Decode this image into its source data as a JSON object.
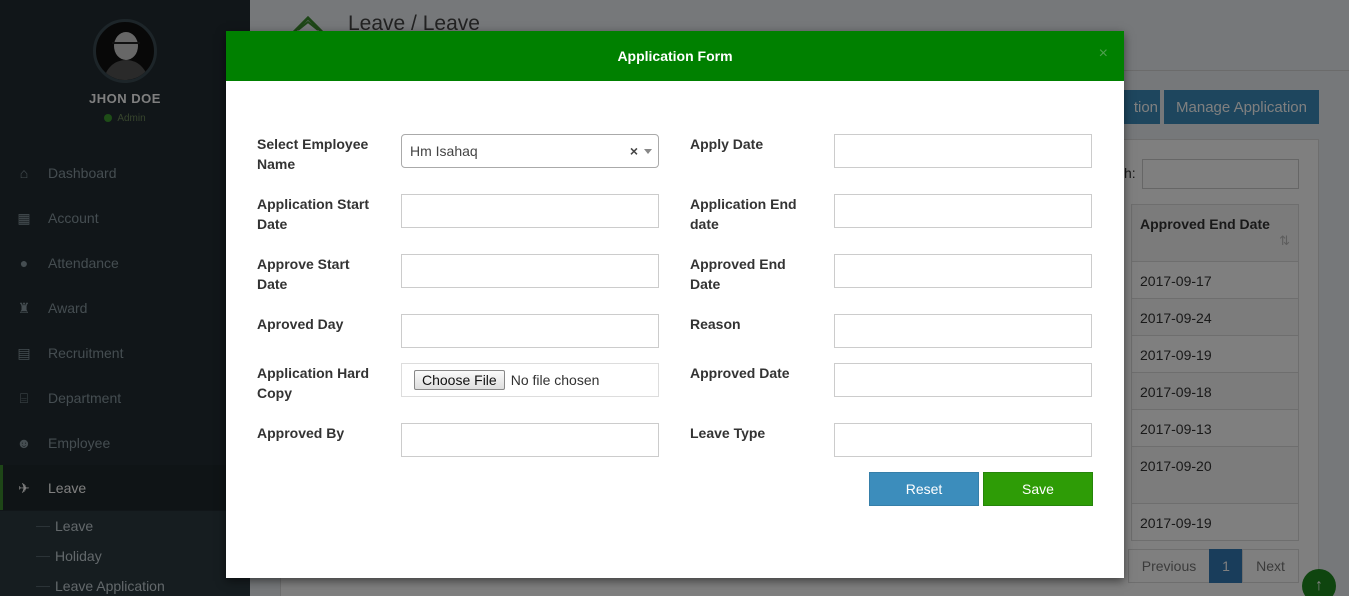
{
  "sidebar": {
    "user_name": "JHON DOE",
    "user_role": "Admin",
    "items": [
      {
        "label": "Dashboard",
        "icon": "home-icon"
      },
      {
        "label": "Account",
        "icon": "calculator-icon"
      },
      {
        "label": "Attendance",
        "icon": "user-icon"
      },
      {
        "label": "Award",
        "icon": "trophy-icon"
      },
      {
        "label": "Recruitment",
        "icon": "newspaper-icon"
      },
      {
        "label": "Department",
        "icon": "bank-icon"
      },
      {
        "label": "Employee",
        "icon": "users-icon"
      },
      {
        "label": "Leave",
        "icon": "plane-icon",
        "active": true
      }
    ],
    "subitems": [
      "Leave",
      "Holiday",
      "Leave Application"
    ]
  },
  "page": {
    "title": "Leave / Leave",
    "btn_application_partial": "tion",
    "btn_manage": "Manage Application",
    "search_label_partial": "h:",
    "table_header": "Approved End Date",
    "table_values": [
      "2017-09-17",
      "2017-09-24",
      "2017-09-19",
      "2017-09-18",
      "2017-09-13",
      "2017-09-20",
      "2017-09-19"
    ],
    "pager": {
      "previous": "Previous",
      "page": "1",
      "next": "Next"
    }
  },
  "modal": {
    "title": "Application Form",
    "close": "×",
    "fields": {
      "employee_name_label": "Select Employee Name",
      "employee_name_value": "Hm Isahaq",
      "apply_date_label": "Apply Date",
      "app_start_label": "Application Start Date",
      "app_end_label": "Application End date",
      "approve_start_label": "Approve Start Date",
      "approved_end_label": "Approved End Date",
      "aproved_day_label": "Aproved Day",
      "reason_label": "Reason",
      "hard_copy_label": "Application Hard Copy",
      "choose_file": "Choose File",
      "no_file": "No file chosen",
      "approved_date_label": "Approved Date",
      "approved_by_label": "Approved By",
      "leave_type_label": "Leave Type"
    },
    "reset_label": "Reset",
    "save_label": "Save"
  },
  "colors": {
    "modal_header": "#008000",
    "sidebar_bg": "#222d32",
    "primary_button": "#3c8dbc",
    "save_button": "#2e9c06"
  }
}
